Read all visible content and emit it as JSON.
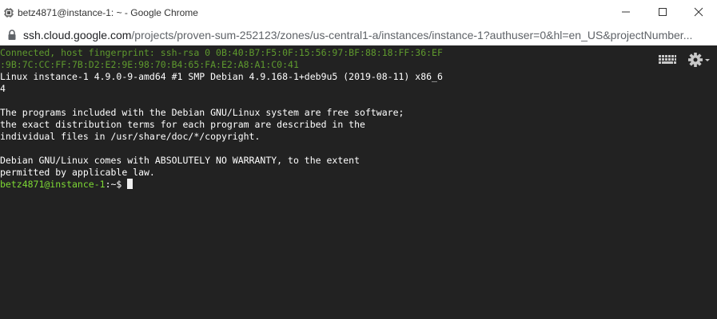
{
  "window": {
    "title": "betz4871@instance-1: ~ - Google Chrome"
  },
  "addressbar": {
    "host": "ssh.cloud.google.com",
    "path": "/projects/proven-sum-252123/zones/us-central1-a/instances/instance-1?authuser=0&hl=en_US&projectNumber..."
  },
  "terminal": {
    "lines": [
      {
        "text": "Connected, host fingerprint: ssh-rsa 0 0B:40:B7:F5:0F:15:56:97:BF:88:18:FF:36:EF",
        "style": "dim"
      },
      {
        "text": ":9B:7C:CC:FF:7B:D2:E2:9E:98:70:B4:65:FA:E2:A8:A1:C0:41",
        "style": "dim"
      },
      {
        "text": "Linux instance-1 4.9.0-9-amd64 #1 SMP Debian 4.9.168-1+deb9u5 (2019-08-11) x86_6",
        "style": "normal"
      },
      {
        "text": "4",
        "style": "normal"
      },
      {
        "text": "",
        "style": "normal"
      },
      {
        "text": "The programs included with the Debian GNU/Linux system are free software;",
        "style": "normal"
      },
      {
        "text": "the exact distribution terms for each program are described in the",
        "style": "normal"
      },
      {
        "text": "individual files in /usr/share/doc/*/copyright.",
        "style": "normal"
      },
      {
        "text": "",
        "style": "normal"
      },
      {
        "text": "Debian GNU/Linux comes with ABSOLUTELY NO WARRANTY, to the extent",
        "style": "normal"
      },
      {
        "text": "permitted by applicable law.",
        "style": "normal"
      }
    ],
    "prompt": {
      "user_host": "betz4871@instance-1",
      "path": ":~$ "
    }
  },
  "icons": {
    "app": "chrome-window-icon",
    "lock": "lock-icon",
    "minimize": "minimize-icon",
    "maximize": "maximize-icon",
    "close": "close-icon",
    "keyboard": "keyboard-icon",
    "settings": "gear-icon"
  },
  "colors": {
    "terminal_bg": "#222222",
    "terminal_text": "#ffffff",
    "fingerprint_text": "#5f9a2e",
    "prompt_user": "#7dd934"
  }
}
